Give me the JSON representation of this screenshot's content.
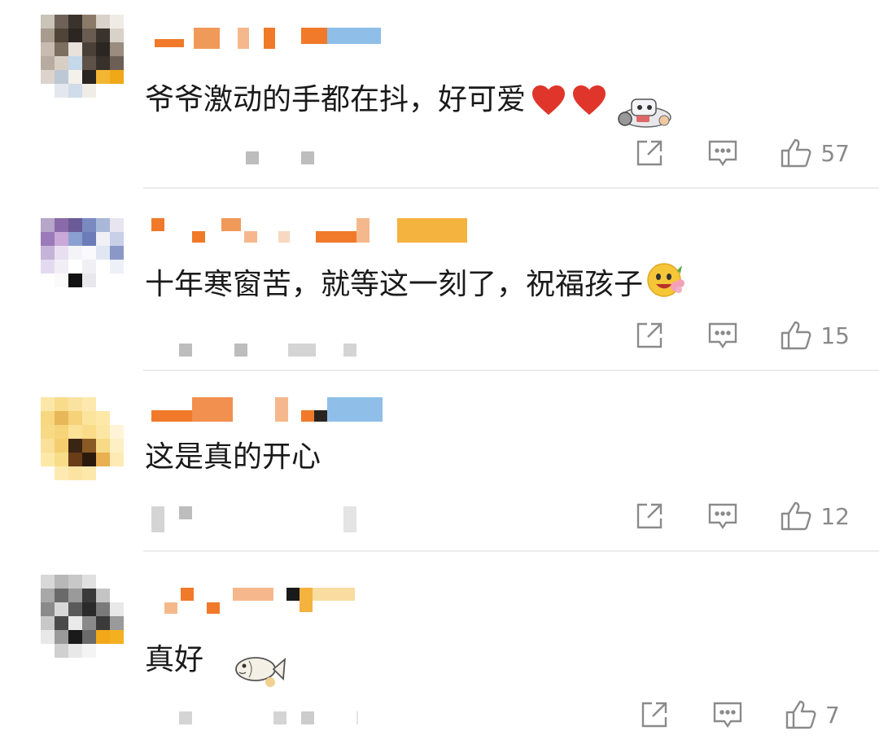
{
  "comments": [
    {
      "text": "爷爷激动的手都在抖，好可爱",
      "stickers": [
        "heart-icon",
        "heart-icon",
        "robot-sticker"
      ],
      "likes": "57"
    },
    {
      "text": "十年寒窗苦，就等这一刻了，祝福孩子",
      "stickers": [
        "flower-face-emoji"
      ],
      "likes": "15"
    },
    {
      "text": "这是真的开心",
      "stickers": [],
      "likes": "12"
    },
    {
      "text": "真好",
      "stickers": [
        "fish-sticker"
      ],
      "likes": "7"
    }
  ],
  "colors": {
    "text": "#1a1a1a",
    "icon": "#8a8a8a",
    "heart": "#e0352b",
    "divider": "#ececec",
    "name_orange": "#f07a2a",
    "name_blue": "#8fbfe8"
  }
}
